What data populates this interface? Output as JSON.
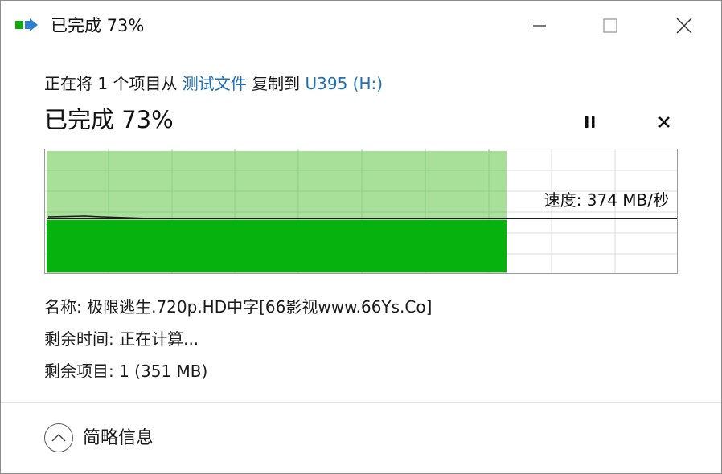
{
  "window": {
    "title": "已完成 73%",
    "icon": "copy-arrow-icon"
  },
  "copy_info": {
    "prefix": "正在将 1 个项目从 ",
    "source": "测试文件",
    "middle": " 复制到 ",
    "destination": "U395 (H:)"
  },
  "progress": {
    "title": "已完成 73%",
    "percent": 73,
    "speed_label": "速度: 374 MB/秒"
  },
  "details": {
    "name": "名称: 极限逃生.720p.HD中字[66影视www.66Ys.Co]",
    "time_remaining": "剩余时间: 正在计算...",
    "items_remaining": "剩余项目: 1 (351 MB)"
  },
  "footer": {
    "toggle_label": "简略信息"
  },
  "colors": {
    "progress_fill": "#06b20d",
    "progress_light": "#a8e09a",
    "link": "#1f6fb5"
  }
}
